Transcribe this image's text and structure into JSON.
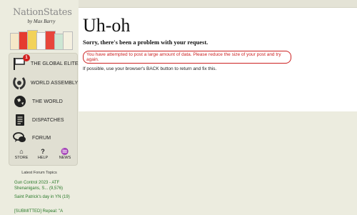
{
  "brand": {
    "logo": "NationStates",
    "byline": "by Max Barry"
  },
  "nav": {
    "items": [
      {
        "label": "THE GLOBAL ELITE",
        "icon": "flag-icon",
        "badge": "1"
      },
      {
        "label": "WORLD ASSEMBLY",
        "icon": "wreath-icon"
      },
      {
        "label": "THE WORLD",
        "icon": "globe-icon"
      },
      {
        "label": "DISPATCHES",
        "icon": "document-icon"
      },
      {
        "label": "FORUM",
        "icon": "speech-bubbles-icon"
      }
    ],
    "bottom": [
      {
        "label": "STORE",
        "icon": "gift-icon"
      },
      {
        "label": "HELP",
        "icon": "question-icon"
      },
      {
        "label": "NEWS",
        "icon": "lightbulb-icon"
      }
    ]
  },
  "forum": {
    "heading": "Latest Forum Topics",
    "topics": [
      "Gun Control 2023 - ATF Shenanigans, S... (9,576)",
      "Saint Patrick's day in YN (19)",
      "[SUBMITTED] Repeal: \"A"
    ]
  },
  "page": {
    "title": "Uh-oh",
    "subtitle": "Sorry, there's been a problem with your request.",
    "error": "You have attempted to post a large amount of data. Please reduce the size of your post and try again.",
    "hint": "If possible, use your browser's BACK button to return and fix this."
  },
  "colors": {
    "error": "#cc2222",
    "link": "#2a7a2a",
    "badge": "#d21e1e"
  }
}
